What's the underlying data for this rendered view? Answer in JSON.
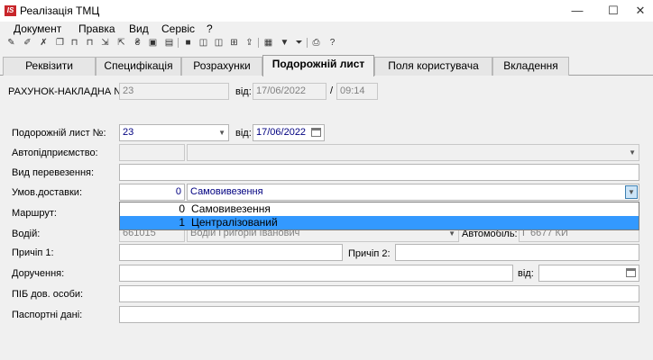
{
  "window": {
    "title": "Реалізація ТМЦ",
    "app_icon": "IS",
    "minimize": "—",
    "maximize": "☐",
    "close": "✕"
  },
  "menu": [
    "Документ",
    "Правка",
    "Вид",
    "Сервіс",
    "?"
  ],
  "toolbar_icons": [
    "new-icon",
    "edit-icon",
    "delete-icon",
    "copy-icon",
    "add-row-icon",
    "add-row2-icon",
    "link-icon",
    "link2-icon",
    "tax-icon",
    "tax2-icon",
    "tax3-icon",
    "save-icon",
    "window-icon",
    "columns-icon",
    "tree-icon",
    "import-icon",
    "grid-icon",
    "filter-icon",
    "filter-dropdown-icon",
    "print-icon",
    "help-icon"
  ],
  "tabs": [
    "Реквізити",
    "Специфікація",
    "Розрахунки",
    "Подорожній лист",
    "Поля користувача",
    "Вкладення"
  ],
  "active_tab": "Подорожній лист",
  "header": {
    "invoice_label": "РАХУНОК-НАКЛАДНА №:",
    "invoice_no": "23",
    "from_label": "від:",
    "invoice_date": "17/06/2022",
    "slash": "/",
    "invoice_time": "09:14"
  },
  "form": {
    "waybill_label": "Подорожній лист №:",
    "waybill_no": "23",
    "waybill_from_label": "від:",
    "waybill_date": "17/06/2022",
    "company_label": "Автопідприємство:",
    "transport_type_label": "Вид перевезення:",
    "delivery_label": "Умов.доставки:",
    "delivery_code": "0",
    "delivery_name": "Самовивезення",
    "route_label": "Маршрут:",
    "driver_label": "Водій:",
    "driver_code": "661015",
    "driver_name": "Водій Григорій Іванович",
    "car_label": "Автомобіль:",
    "car_value": "Г 6677 КИ",
    "trailer1_label": "Причіп 1:",
    "trailer2_label": "Причіп 2:",
    "power_of_attorney_label": "Доручення:",
    "poa_from_label": "від:",
    "person_label": "ПІБ дов. особи:",
    "passport_label": "Паспортні дані:"
  },
  "delivery_options": [
    {
      "code": "0",
      "name": "Самовивезення",
      "selected": false
    },
    {
      "code": "1",
      "name": "Централізований",
      "selected": true
    }
  ]
}
